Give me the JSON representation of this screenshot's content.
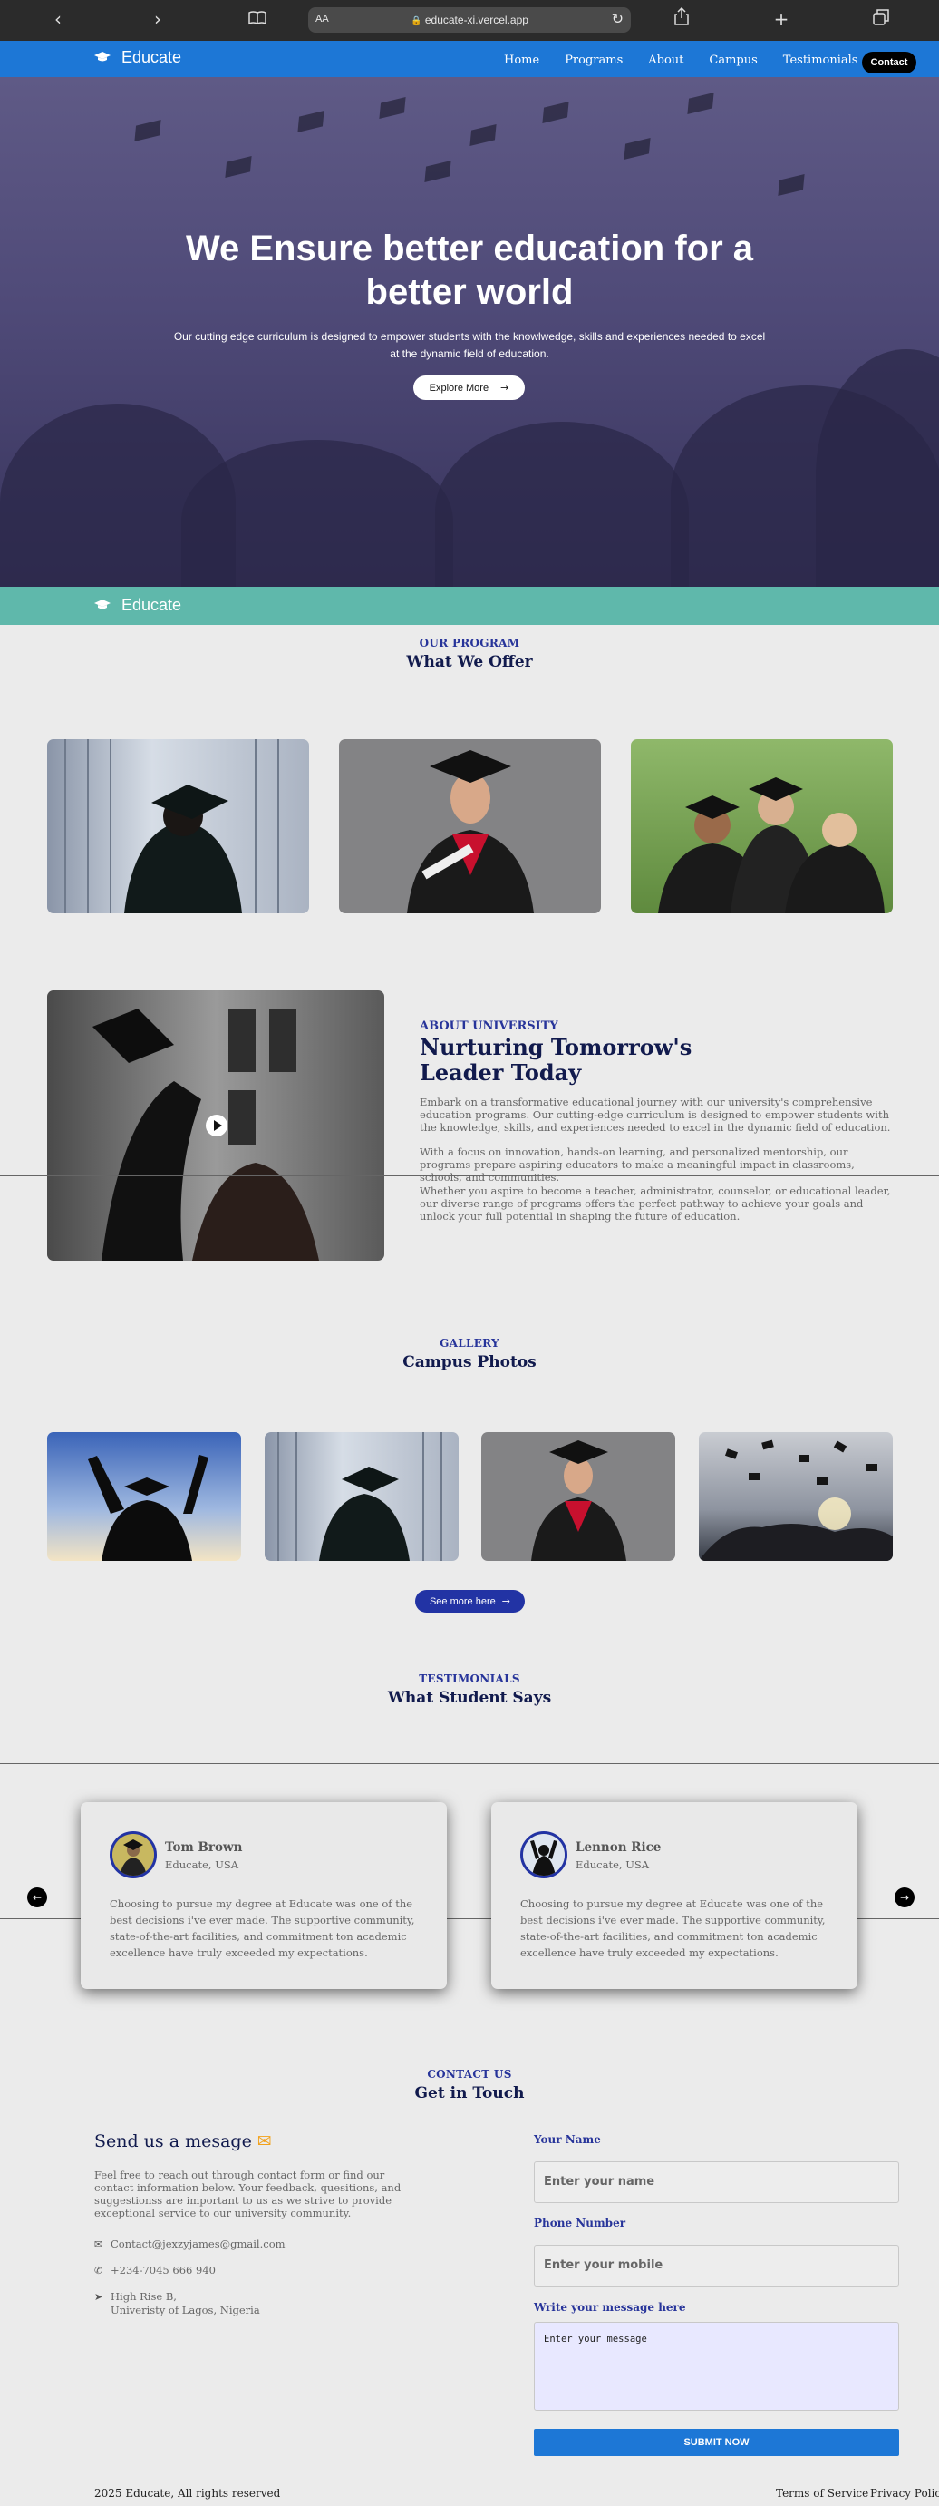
{
  "browser": {
    "text_size_label": "AA",
    "url": "educate-xi.vercel.app"
  },
  "nav": {
    "brand": "Educate",
    "links": [
      "Home",
      "Programs",
      "About",
      "Campus",
      "Testimonials"
    ],
    "contact_label": "Contact"
  },
  "hero": {
    "title": "We Ensure better education for a better world",
    "subtitle": "Our cutting edge curriculum is designed to empower students with the knowlwedge, skills and experiences needed to excel at the dynamic field of education.",
    "button_label": "Explore More"
  },
  "band": {
    "brand": "Educate"
  },
  "program": {
    "kicker": "OUR PROGRAM",
    "title": "What We Offer"
  },
  "about": {
    "kicker": "ABOUT UNIVERSITY",
    "title": "Nurturing Tomorrow's Leader Today",
    "paragraphs": [
      "Embark on a transformative educational journey with our university's comprehensive education programs. Our cutting-edge curriculum is designed to empower students with the knowledge, skills, and experiences needed to excel in the dynamic field of education.",
      "With a focus on innovation, hands-on learning, and personalized mentorship, our programs prepare aspiring educators to make a meaningful impact in classrooms, schools, and communities.",
      "Whether you aspire to become a teacher, administrator, counselor, or educational leader, our diverse range of programs offers the perfect pathway to achieve your goals and unlock your full potential in shaping the future of education."
    ]
  },
  "gallery": {
    "kicker": "GALLERY",
    "title": "Campus Photos",
    "button_label": "See more here"
  },
  "testimonials": {
    "kicker": "TESTIMONIALS",
    "title": "What Student Says",
    "items": [
      {
        "name": "Tom Brown",
        "location": "Educate, USA",
        "text": "Choosing to pursue my degree at Educate was one of the best decisions i've ever made. The supportive community, state-of-the-art facilities, and commitment ton academic excellence have truly exceeded my expectations."
      },
      {
        "name": "Lennon Rice",
        "location": "Educate, USA",
        "text": "Choosing to pursue my degree at Educate was one of the best decisions i've ever made. The supportive community, state-of-the-art facilities, and commitment ton academic excellence have truly exceeded my expectations."
      }
    ]
  },
  "contact": {
    "kicker": "CONTACT US",
    "title": "Get in Touch",
    "message_title": "Send us a mesage",
    "description": "Feel free to reach out through contact form or find our contact information below. Your feedback, quesitions, and suggestionss are important to us as we strive to provide exceptional service to our university community.",
    "email": "Contact@jexzyjames@gmail.com",
    "phone": "+234-7045 666 940",
    "address_line1": "High Rise B,",
    "address_line2": "Univeristy of Lagos, Nigeria",
    "form": {
      "name_label": "Your Name",
      "name_placeholder": "Enter your name",
      "phone_label": "Phone Number",
      "phone_placeholder": "Enter your mobile",
      "message_label": "Write your message here",
      "message_placeholder": "Enter your message",
      "submit_label": "SUBMIT NOW"
    }
  },
  "footer": {
    "copyright": "2025 Educate, All rights reserved",
    "terms": "Terms of Service",
    "privacy": "Privacy Policy"
  }
}
